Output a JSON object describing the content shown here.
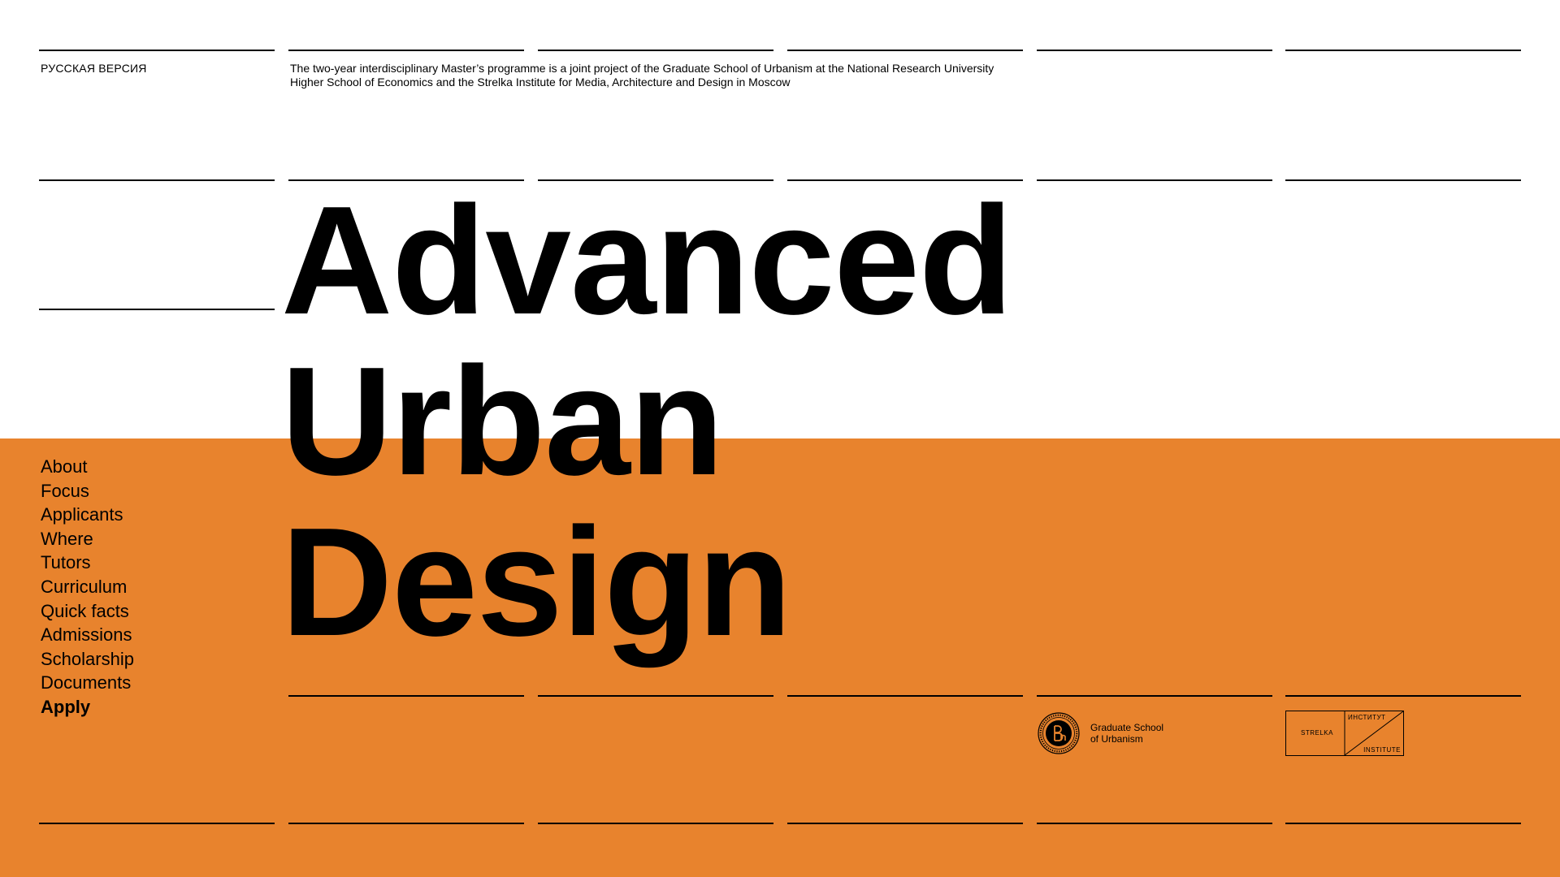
{
  "header": {
    "lang_link": "РУССКАЯ ВЕРСИЯ",
    "intro_line1": "The two-year interdisciplinary Master’s programme is a joint project of the Graduate School of Urbanism at the National Research University",
    "intro_line2": "Higher School of Economics and the Strelka Institute for Media, Architecture and Design in Moscow"
  },
  "title": {
    "line1": "Advanced",
    "line2": "Urban",
    "line3": "Design"
  },
  "nav": {
    "items": [
      {
        "label": "About"
      },
      {
        "label": "Focus"
      },
      {
        "label": "Applicants"
      },
      {
        "label": "Where"
      },
      {
        "label": "Tutors"
      },
      {
        "label": "Curriculum"
      },
      {
        "label": "Quick facts"
      },
      {
        "label": "Admissions"
      },
      {
        "label": "Scholarship"
      },
      {
        "label": "Documents"
      },
      {
        "label": "Apply"
      }
    ]
  },
  "logos": {
    "hse": {
      "line1": "Graduate School",
      "line2": "of Urbanism",
      "icon": "hse-seal-icon"
    },
    "strelka": {
      "left": "STRELKA",
      "top_right": "ИНСТИТУТ",
      "bottom_right": "INSTITUTE"
    }
  },
  "colors": {
    "accent": "#e8832d",
    "text": "#000000",
    "background": "#ffffff"
  }
}
